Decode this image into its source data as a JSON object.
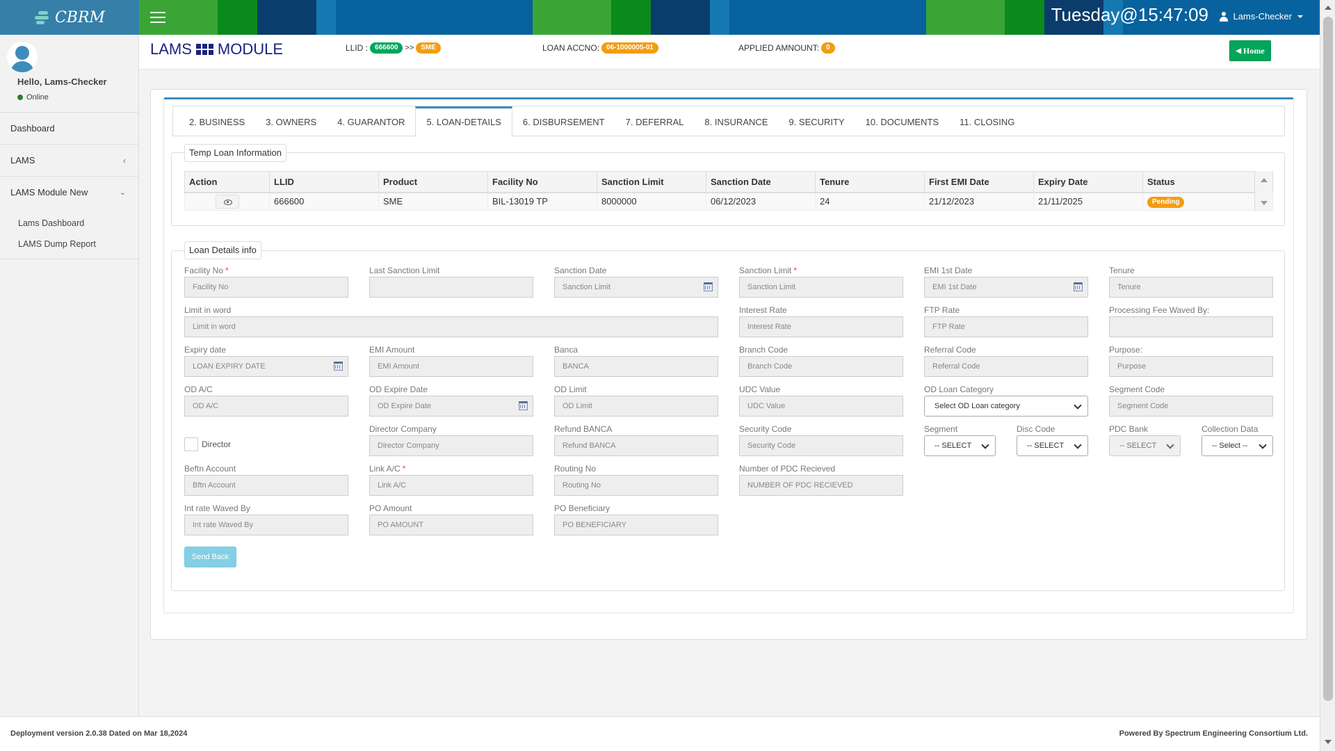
{
  "brand": {
    "name": "CBRM"
  },
  "header": {
    "datetime": "Tuesday@15:47:09",
    "user_name": "Lams-Checker"
  },
  "sidebar": {
    "greeting": "Hello, Lams-Checker",
    "status": "Online",
    "items": [
      {
        "label": "Dashboard"
      },
      {
        "label": "LAMS"
      },
      {
        "label": "LAMS Module New"
      }
    ],
    "sub_items": [
      {
        "label": "Lams Dashboard"
      },
      {
        "label": "LAMS Dump Report"
      }
    ]
  },
  "module": {
    "title_left": "LAMS",
    "title_right": "MODULE",
    "llid_label": "LLID :",
    "llid_value": "666600",
    "separator": ">>",
    "llid_product": "SME",
    "loan_accno_label": "LOAN ACCNO:",
    "loan_accno_value": "06-1000005-01",
    "applied_amount_label": "APPLIED AMNOUNT:",
    "applied_amount_value": "0",
    "home_label": "Home"
  },
  "tabs": [
    {
      "label": "2. BUSINESS"
    },
    {
      "label": "3. OWNERS"
    },
    {
      "label": "4. GUARANTOR"
    },
    {
      "label": "5. LOAN-DETAILS"
    },
    {
      "label": "6. DISBURSEMENT"
    },
    {
      "label": "7. DEFERRAL"
    },
    {
      "label": "8. INSURANCE"
    },
    {
      "label": "9. SECURITY"
    },
    {
      "label": "10. DOCUMENTS"
    },
    {
      "label": "11. CLOSING"
    }
  ],
  "temp_loan": {
    "legend": "Temp Loan Information",
    "columns": [
      "Action",
      "LLID",
      "Product",
      "Facility No",
      "Sanction Limit",
      "Sanction Date",
      "Tenure",
      "First EMI Date",
      "Expiry Date",
      "Status"
    ],
    "row": {
      "llid": "666600",
      "product": "SME",
      "facility_no": "BIL-13019 TP",
      "sanction_limit": "8000000",
      "sanction_date": "06/12/2023",
      "tenure": "24",
      "first_emi_date": "21/12/2023",
      "expiry_date": "21/11/2025",
      "status": "Pending"
    }
  },
  "loan_details": {
    "legend": "Loan Details info",
    "facility_no": {
      "label": "Facility No",
      "placeholder": "Facility No"
    },
    "last_sanction_limit": {
      "label": "Last Sanction Limit",
      "placeholder": ""
    },
    "sanction_date": {
      "label": "Sanction Date",
      "placeholder": "Sanction Limit"
    },
    "sanction_limit": {
      "label": "Sanction Limit",
      "placeholder": "Sanction Limit"
    },
    "emi_1st_date": {
      "label": "EMI 1st Date",
      "placeholder": "EMI 1st Date"
    },
    "tenure": {
      "label": "Tenure",
      "placeholder": "Tenure"
    },
    "limit_in_word": {
      "label": "Limit in word",
      "placeholder": "Limit in word"
    },
    "interest_rate": {
      "label": "Interest Rate",
      "placeholder": "Interest Rate"
    },
    "ftp_rate": {
      "label": "FTP Rate",
      "placeholder": "FTP Rate"
    },
    "processing_fee": {
      "label": "Processing Fee Waved By:",
      "placeholder": ""
    },
    "expiry_date": {
      "label": "Expiry date",
      "placeholder": "LOAN EXPIRY DATE"
    },
    "emi_amount": {
      "label": "EMI Amount",
      "placeholder": "EMI Amount"
    },
    "banca": {
      "label": "Banca",
      "placeholder": "BANCA"
    },
    "branch_code": {
      "label": "Branch Code",
      "placeholder": "Branch Code"
    },
    "referral_code": {
      "label": "Referral Code",
      "placeholder": "Referral Code"
    },
    "purpose": {
      "label": "Purpose:",
      "placeholder": "Purpose"
    },
    "od_ac": {
      "label": "OD A/C",
      "placeholder": "OD A/C"
    },
    "od_expire_date": {
      "label": "OD Expire Date",
      "placeholder": "OD Expire Date"
    },
    "od_limit": {
      "label": "OD Limit",
      "placeholder": "OD Limit"
    },
    "udc_value": {
      "label": "UDC Value",
      "placeholder": "UDC Value"
    },
    "od_loan_category": {
      "label": "OD Loan Category",
      "selected": "Select OD Loan category"
    },
    "segment_code": {
      "label": "Segment Code",
      "placeholder": "Segment Code"
    },
    "director": {
      "label": "Director"
    },
    "director_company": {
      "label": "Director Company",
      "placeholder": "Director Company"
    },
    "refund_banca": {
      "label": "Refund BANCA",
      "placeholder": "Refund BANCA"
    },
    "security_code": {
      "label": "Security Code",
      "placeholder": "Security Code"
    },
    "segment": {
      "label": "Segment",
      "selected": "-- SELECT"
    },
    "disc_code": {
      "label": "Disc Code",
      "selected": "-- SELECT"
    },
    "pdc_bank": {
      "label": "PDC Bank",
      "selected": "-- SELECT"
    },
    "collection_data": {
      "label": "Collection Data",
      "selected": "-- Select --"
    },
    "beftn_account": {
      "label": "Beftn Account",
      "placeholder": "Bftn Account"
    },
    "link_ac": {
      "label": "Link A/C",
      "placeholder": "Link A/C"
    },
    "routing_no": {
      "label": "Routing No",
      "placeholder": "Routing No"
    },
    "number_of_pdc": {
      "label": "Number of PDC Recieved",
      "placeholder": "NUMBER OF PDC RECIEVED"
    },
    "int_rate_waved": {
      "label": "Int rate Waved By",
      "placeholder": "Int rate Waved By"
    },
    "po_amount": {
      "label": "PO Amount",
      "placeholder": "PO AMOUNT"
    },
    "po_beneficiary": {
      "label": "PO Beneficiary",
      "placeholder": "PO BENEFICIARY"
    },
    "required_mark": "*",
    "send_back_label": "Send Back"
  },
  "footer": {
    "left": "Deployment version 2.0.38 Dated on Mar 18,2024",
    "right": "Powered By Spectrum Engineering Consortium Ltd."
  },
  "icons": {
    "menu": "hamburger-icon",
    "user": "user-icon",
    "calendar": "calendar-icon",
    "view": "eye-icon",
    "grid": "grid-icon"
  },
  "colors": {
    "primary": "#3c8dbc",
    "success": "#00a65a",
    "warning": "#f39c12",
    "info": "#5bc0de",
    "module_title": "#1a237e"
  }
}
